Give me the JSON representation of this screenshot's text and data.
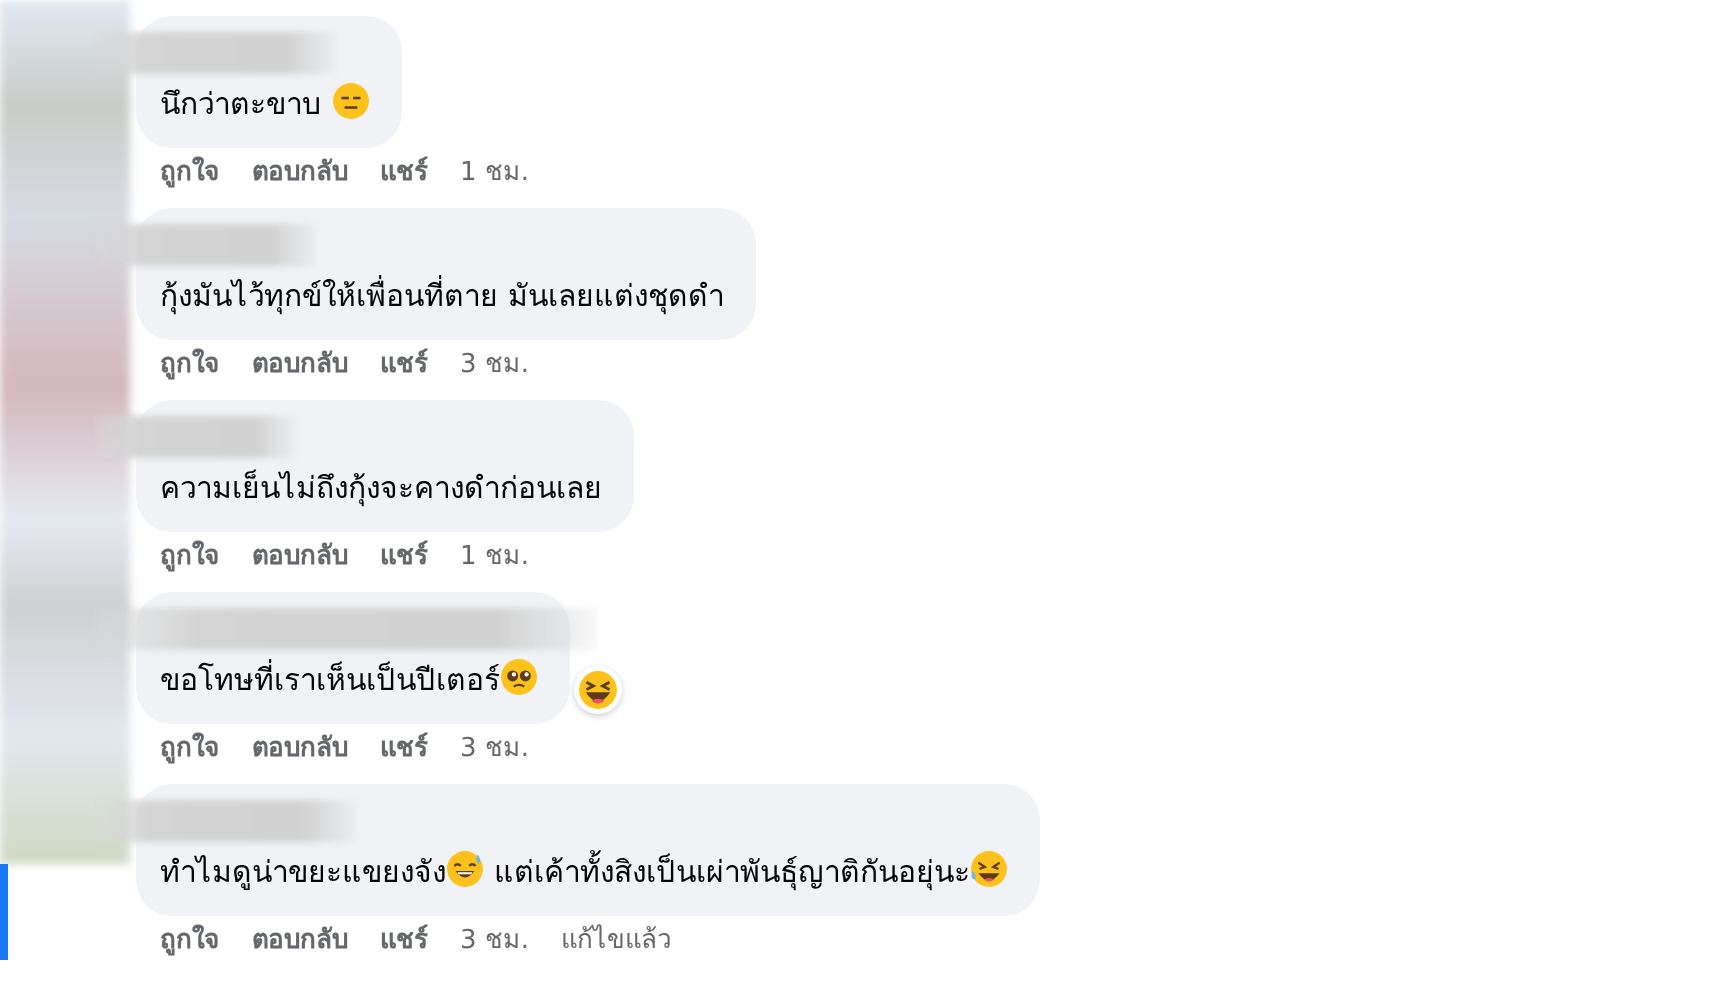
{
  "comments": [
    {
      "body": [
        {
          "kind": "text",
          "text": "นึกว่าตะขาบ "
        },
        {
          "kind": "meh"
        }
      ],
      "actions": [
        "ถูกใจ",
        "ตอบกลับ",
        "แชร์"
      ],
      "time": "1 ชม."
    },
    {
      "body": [
        {
          "kind": "text",
          "text": "กุ้งมันไว้ทุกข์ให้เพื่อนที่ตาย มันเลยแต่งชุดดำ"
        }
      ],
      "actions": [
        "ถูกใจ",
        "ตอบกลับ",
        "แชร์"
      ],
      "time": "3 ชม."
    },
    {
      "body": [
        {
          "kind": "text",
          "text": "ความเย็นไม่ถึงกุ้งจะคางดำก่อนเลย"
        }
      ],
      "actions": [
        "ถูกใจ",
        "ตอบกลับ",
        "แชร์"
      ],
      "time": "1 ชม."
    },
    {
      "body": [
        {
          "kind": "text",
          "text": "ขอโทษที่เราเห็นเป็นปีเตอร์"
        },
        {
          "kind": "pleading"
        }
      ],
      "reaction_badge": true,
      "actions": [
        "ถูกใจ",
        "ตอบกลับ",
        "แชร์"
      ],
      "time": "3 ชม."
    },
    {
      "body": [
        {
          "kind": "text",
          "text": "ทำไมดูน่าขยะแขยงจัง"
        },
        {
          "kind": "sweat"
        },
        {
          "kind": "text",
          "text": " แต่เค้าทั้งสิงเป็นเผ่าพันธุ์ญาติกันอยุ่นะ"
        },
        {
          "kind": "rofl"
        }
      ],
      "actions": [
        "ถูกใจ",
        "ตอบกลับ",
        "แชร์"
      ],
      "time": "3 ชม.",
      "edited": "แก้ไขแล้ว"
    }
  ]
}
